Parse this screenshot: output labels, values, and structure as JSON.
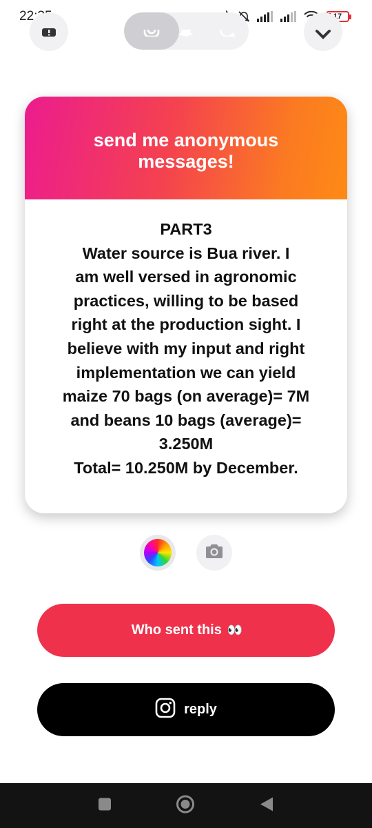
{
  "status_bar": {
    "time": "22:35",
    "battery_level": "17",
    "icons": [
      "bluetooth-icon",
      "bell-off-icon",
      "signal-icon",
      "signal-icon",
      "wifi-icon",
      "battery-icon"
    ]
  },
  "top_bar": {
    "left_icon": "help-icon",
    "share_targets": [
      "instagram-icon",
      "snapchat-icon",
      "whatsapp-icon"
    ],
    "right_icon": "close-icon"
  },
  "card": {
    "header": [
      "send me anonymous",
      "messages!"
    ],
    "message_lines": [
      "PART3",
      "Water source is Bua river. I",
      "am well versed in agronomic",
      "practices, willing to be based",
      "right at the production sight. I",
      "believe with my input and right",
      "implementation we can yield",
      "maize 70 bags (on average)= 7M",
      "and beans 10 bags (average)=",
      "3.250M",
      "Total= 10.250M by December."
    ]
  },
  "tools": {
    "color_icon": "color-wheel-icon",
    "camera_icon": "camera-icon"
  },
  "buttons": {
    "who_sent": "Who sent this",
    "who_sent_emoji": "👀",
    "reply": "reply"
  },
  "colors": {
    "gradient_start": "#ec1c8e",
    "gradient_end": "#fe8a15",
    "who_button": "#ef314b",
    "reply_button": "#000000"
  },
  "nav_bar": {
    "icons": [
      "recents-icon",
      "home-icon",
      "back-icon"
    ]
  }
}
